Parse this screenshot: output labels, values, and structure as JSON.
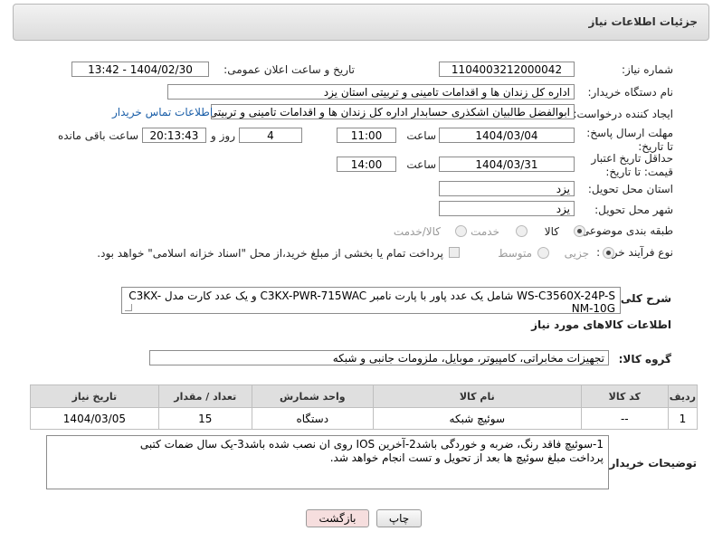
{
  "header": {
    "title": "جزئیات اطلاعات نیاز"
  },
  "form": {
    "need_number_label": "شماره نیاز:",
    "need_number": "1104003212000042",
    "announce_label": "تاریخ و ساعت اعلان عمومی:",
    "announce_value": "1404/02/30 - 13:42",
    "buyer_org_label": "نام دستگاه خریدار:",
    "buyer_org": "اداره کل زندان ها و اقدامات تامینی و تربیتی استان یزد",
    "creator_label": "ایجاد کننده درخواست:",
    "creator": "ابوالفضل  طالبیان اشکذری حسابدار اداره کل زندان ها و اقدامات تامینی و تربیتی",
    "contact_link": "اطلاعات تماس خریدار",
    "reply_deadline_label": "مهلت ارسال پاسخ: تا تاریخ:",
    "reply_date": "1404/03/04",
    "time_label": "ساعت",
    "reply_time": "11:00",
    "days_value": "4",
    "days_label": "روز و",
    "remaining_time": "20:13:43",
    "remaining_label": "ساعت باقی مانده",
    "min_price_label": "حداقل تاریخ اعتبار قیمت: تا تاریخ:",
    "price_date": "1404/03/31",
    "price_time": "14:00",
    "province_label": "استان محل تحویل:",
    "province": "یزد",
    "city_label": "شهر محل تحویل:",
    "city": "یزد",
    "category_label": "طبقه بندی موضوعی:",
    "category_options": [
      "کالا",
      "خدمت",
      "کالا/خدمت"
    ],
    "process_label": "نوع فرآیند خرید :",
    "process_options": [
      "جزیی",
      "متوسط"
    ],
    "payment_note": "پرداخت تمام یا بخشی از مبلغ خرید،از محل \"اسناد خزانه اسلامی\" خواهد بود."
  },
  "description": {
    "label": "شرح کلی نیاز:",
    "text": "WS-C3560X-24P-S  شامل یک عدد پاور با پارت نامبر C3KX-PWR-715WAC و یک عدد کارت مدل C3KX-NM-10G"
  },
  "goods": {
    "section_title": "اطلاعات کالاهای مورد نیاز",
    "group_label": "گروه کالا:",
    "group_value": "تجهیزات مخابراتی، کامپیوتر، موبایل، ملزومات جانبی و شبکه",
    "columns": [
      "ردیف",
      "کد کالا",
      "نام کالا",
      "واحد شمارش",
      "تعداد / مقدار",
      "تاریخ نیاز"
    ],
    "rows": [
      {
        "index": "1",
        "code": "--",
        "name": "سوئیچ شبکه",
        "unit": "دستگاه",
        "qty": "15",
        "date": "1404/03/05"
      }
    ]
  },
  "notes": {
    "label": "توضیحات خریدار:",
    "line1": "1-سوئیچ فاقد رنگ، ضربه و خوردگی باشد2-آخرین IOS روی ان نصب شده باشد3-یک سال ضمات کتبی",
    "line2": "پرداخت مبلغ سوئیچ ها بعد از تحویل و تست انجام خواهد شد."
  },
  "buttons": {
    "print": "چاپ",
    "back": "بازگشت"
  },
  "colors": {
    "link": "#1a5ea8",
    "back_button_bg": "#f6dede"
  }
}
